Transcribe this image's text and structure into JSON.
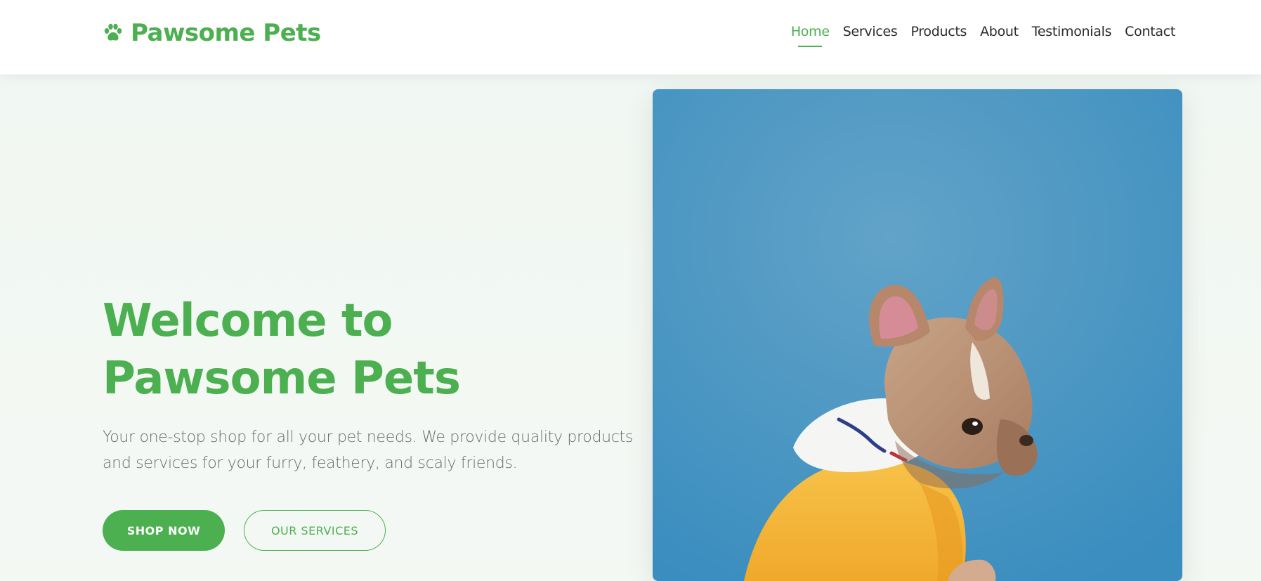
{
  "brand": {
    "name": "Pawsome Pets",
    "icon": "paw-icon",
    "color": "#4caf50"
  },
  "nav": {
    "items": [
      {
        "label": "Home",
        "active": true
      },
      {
        "label": "Services",
        "active": false
      },
      {
        "label": "Products",
        "active": false
      },
      {
        "label": "About",
        "active": false
      },
      {
        "label": "Testimonials",
        "active": false
      },
      {
        "label": "Contact",
        "active": false
      }
    ]
  },
  "hero": {
    "title_line1": "Welcome to",
    "title_line2": "Pawsome Pets",
    "subtitle": "Your one-stop shop for all your pet needs. We provide quality products and services for your furry, feathery, and scaly friends.",
    "primary_button": "SHOP NOW",
    "secondary_button": "OUR SERVICES",
    "image": "french-bulldog-in-yellow-hoodie-photo"
  },
  "colors": {
    "accent": "#4caf50",
    "text_dark": "#2b2b2b",
    "text_muted": "#6b6b6b",
    "image_background": "#4a9ac8"
  }
}
